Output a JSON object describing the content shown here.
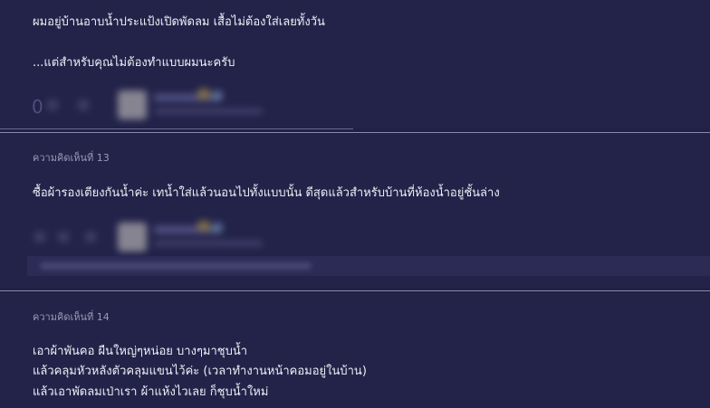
{
  "previous_comment": {
    "lines": [
      "ผมอยู่บ้านอาบน้ำประแป้งเปิดพัดลม เสื้อไม่ต้องใส่เลยทั้งวัน",
      "...แต่สำหรับคุณไม่ต้องทำแบบผมนะครับ"
    ],
    "vote_count": "0"
  },
  "comment_13": {
    "label": "ความคิดเห็นที่ 13",
    "lines": [
      "ซื้อผ้ารองเตียงกันน้ำค่ะ เทน้ำใส่แล้วนอนไปทั้งแบบนั้น  ดีสุดแล้วสำหรับบ้านที่ห้องน้ำอยู่ชั้นล่าง"
    ]
  },
  "comment_14": {
    "label": "ความคิดเห็นที่ 14",
    "lines": [
      "เอาผ้าพันคอ ผืนใหญ่ๆหน่อย บางๆมาชุบน้ำ",
      "แล้วคลุมหัวหลังตัวคลุมแขนไว้ค่ะ (เวลาทำงานหน้าคอมอยู่ในบ้าน)",
      "แล้วเอาพัดลมเป่าเรา  ผ้าแห้งไวเลย ก็ชุบน้ำใหม่"
    ]
  },
  "icons": {
    "avatar": "user-avatar-blurred",
    "vote_up": "thumbs-up-icon",
    "vote_emotion": "emotion-icon",
    "badge": "member-badge-icon"
  },
  "colors": {
    "background": "#202044",
    "card": "#23234a",
    "separator": "#8a8ab0",
    "muted_text": "#9a9ab8",
    "text": "#eeeef6"
  }
}
